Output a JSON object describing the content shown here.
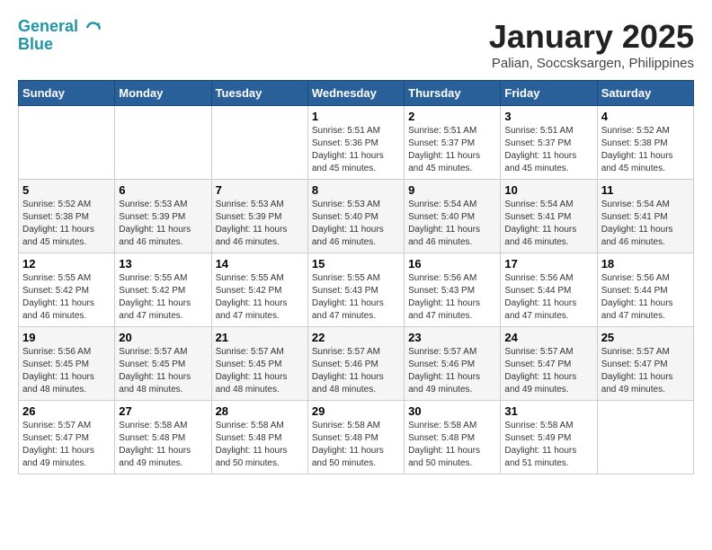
{
  "header": {
    "logo_line1": "General",
    "logo_line2": "Blue",
    "title": "January 2025",
    "subtitle": "Palian, Soccsksargen, Philippines"
  },
  "days_of_week": [
    "Sunday",
    "Monday",
    "Tuesday",
    "Wednesday",
    "Thursday",
    "Friday",
    "Saturday"
  ],
  "weeks": [
    [
      {
        "day": "",
        "info": ""
      },
      {
        "day": "",
        "info": ""
      },
      {
        "day": "",
        "info": ""
      },
      {
        "day": "1",
        "info": "Sunrise: 5:51 AM\nSunset: 5:36 PM\nDaylight: 11 hours\nand 45 minutes."
      },
      {
        "day": "2",
        "info": "Sunrise: 5:51 AM\nSunset: 5:37 PM\nDaylight: 11 hours\nand 45 minutes."
      },
      {
        "day": "3",
        "info": "Sunrise: 5:51 AM\nSunset: 5:37 PM\nDaylight: 11 hours\nand 45 minutes."
      },
      {
        "day": "4",
        "info": "Sunrise: 5:52 AM\nSunset: 5:38 PM\nDaylight: 11 hours\nand 45 minutes."
      }
    ],
    [
      {
        "day": "5",
        "info": "Sunrise: 5:52 AM\nSunset: 5:38 PM\nDaylight: 11 hours\nand 45 minutes."
      },
      {
        "day": "6",
        "info": "Sunrise: 5:53 AM\nSunset: 5:39 PM\nDaylight: 11 hours\nand 46 minutes."
      },
      {
        "day": "7",
        "info": "Sunrise: 5:53 AM\nSunset: 5:39 PM\nDaylight: 11 hours\nand 46 minutes."
      },
      {
        "day": "8",
        "info": "Sunrise: 5:53 AM\nSunset: 5:40 PM\nDaylight: 11 hours\nand 46 minutes."
      },
      {
        "day": "9",
        "info": "Sunrise: 5:54 AM\nSunset: 5:40 PM\nDaylight: 11 hours\nand 46 minutes."
      },
      {
        "day": "10",
        "info": "Sunrise: 5:54 AM\nSunset: 5:41 PM\nDaylight: 11 hours\nand 46 minutes."
      },
      {
        "day": "11",
        "info": "Sunrise: 5:54 AM\nSunset: 5:41 PM\nDaylight: 11 hours\nand 46 minutes."
      }
    ],
    [
      {
        "day": "12",
        "info": "Sunrise: 5:55 AM\nSunset: 5:42 PM\nDaylight: 11 hours\nand 46 minutes."
      },
      {
        "day": "13",
        "info": "Sunrise: 5:55 AM\nSunset: 5:42 PM\nDaylight: 11 hours\nand 47 minutes."
      },
      {
        "day": "14",
        "info": "Sunrise: 5:55 AM\nSunset: 5:42 PM\nDaylight: 11 hours\nand 47 minutes."
      },
      {
        "day": "15",
        "info": "Sunrise: 5:55 AM\nSunset: 5:43 PM\nDaylight: 11 hours\nand 47 minutes."
      },
      {
        "day": "16",
        "info": "Sunrise: 5:56 AM\nSunset: 5:43 PM\nDaylight: 11 hours\nand 47 minutes."
      },
      {
        "day": "17",
        "info": "Sunrise: 5:56 AM\nSunset: 5:44 PM\nDaylight: 11 hours\nand 47 minutes."
      },
      {
        "day": "18",
        "info": "Sunrise: 5:56 AM\nSunset: 5:44 PM\nDaylight: 11 hours\nand 47 minutes."
      }
    ],
    [
      {
        "day": "19",
        "info": "Sunrise: 5:56 AM\nSunset: 5:45 PM\nDaylight: 11 hours\nand 48 minutes."
      },
      {
        "day": "20",
        "info": "Sunrise: 5:57 AM\nSunset: 5:45 PM\nDaylight: 11 hours\nand 48 minutes."
      },
      {
        "day": "21",
        "info": "Sunrise: 5:57 AM\nSunset: 5:45 PM\nDaylight: 11 hours\nand 48 minutes."
      },
      {
        "day": "22",
        "info": "Sunrise: 5:57 AM\nSunset: 5:46 PM\nDaylight: 11 hours\nand 48 minutes."
      },
      {
        "day": "23",
        "info": "Sunrise: 5:57 AM\nSunset: 5:46 PM\nDaylight: 11 hours\nand 49 minutes."
      },
      {
        "day": "24",
        "info": "Sunrise: 5:57 AM\nSunset: 5:47 PM\nDaylight: 11 hours\nand 49 minutes."
      },
      {
        "day": "25",
        "info": "Sunrise: 5:57 AM\nSunset: 5:47 PM\nDaylight: 11 hours\nand 49 minutes."
      }
    ],
    [
      {
        "day": "26",
        "info": "Sunrise: 5:57 AM\nSunset: 5:47 PM\nDaylight: 11 hours\nand 49 minutes."
      },
      {
        "day": "27",
        "info": "Sunrise: 5:58 AM\nSunset: 5:48 PM\nDaylight: 11 hours\nand 49 minutes."
      },
      {
        "day": "28",
        "info": "Sunrise: 5:58 AM\nSunset: 5:48 PM\nDaylight: 11 hours\nand 50 minutes."
      },
      {
        "day": "29",
        "info": "Sunrise: 5:58 AM\nSunset: 5:48 PM\nDaylight: 11 hours\nand 50 minutes."
      },
      {
        "day": "30",
        "info": "Sunrise: 5:58 AM\nSunset: 5:48 PM\nDaylight: 11 hours\nand 50 minutes."
      },
      {
        "day": "31",
        "info": "Sunrise: 5:58 AM\nSunset: 5:49 PM\nDaylight: 11 hours\nand 51 minutes."
      },
      {
        "day": "",
        "info": ""
      }
    ]
  ]
}
